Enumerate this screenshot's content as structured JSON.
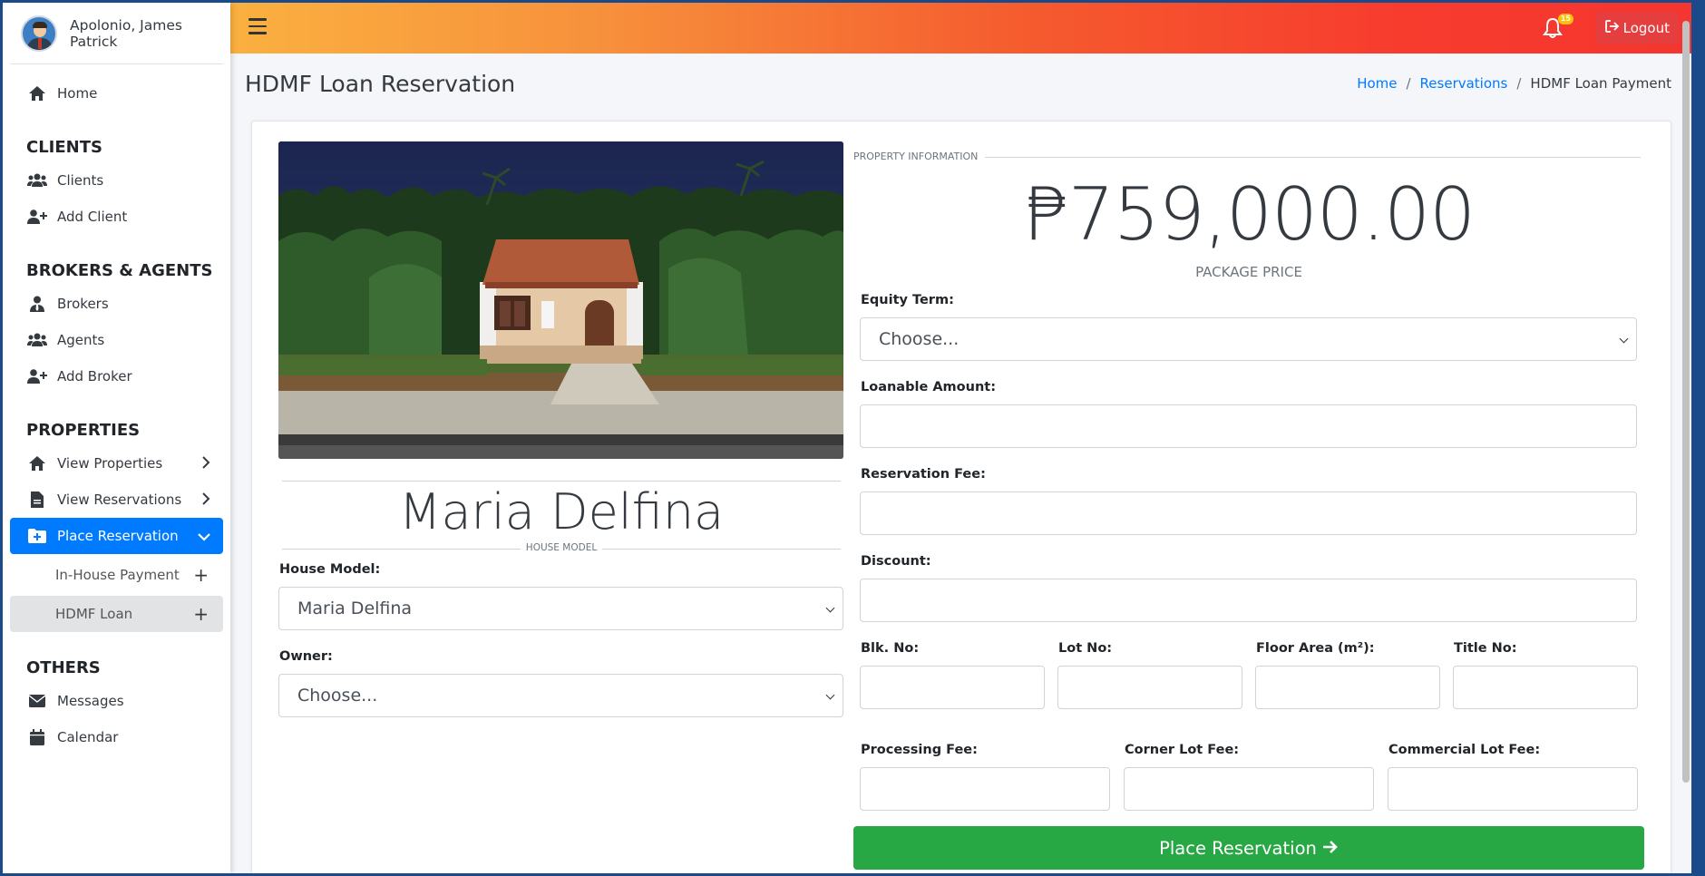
{
  "user": {
    "name": "Apolonio, James Patrick"
  },
  "sidebar": {
    "home": "Home",
    "sections": [
      {
        "header": "CLIENTS",
        "items": [
          {
            "label": "Clients",
            "icon": "users-icon"
          },
          {
            "label": "Add Client",
            "icon": "user-plus-icon"
          }
        ]
      },
      {
        "header": "BROKERS & AGENTS",
        "items": [
          {
            "label": "Brokers",
            "icon": "user-tie-icon"
          },
          {
            "label": "Agents",
            "icon": "users-icon"
          },
          {
            "label": "Add Broker",
            "icon": "user-plus-icon"
          }
        ]
      },
      {
        "header": "PROPERTIES",
        "items": [
          {
            "label": "View Properties",
            "icon": "home-icon"
          },
          {
            "label": "View Reservations",
            "icon": "file-icon"
          },
          {
            "label": "Place Reservation",
            "icon": "folder-plus-icon"
          }
        ]
      },
      {
        "header": "OTHERS",
        "items": [
          {
            "label": "Messages",
            "icon": "envelope-icon"
          },
          {
            "label": "Calendar",
            "icon": "calendar-icon"
          }
        ]
      }
    ],
    "subitems": [
      {
        "label": "In-House Payment"
      },
      {
        "label": "HDMF Loan"
      }
    ]
  },
  "topbar": {
    "notification_count": "15",
    "logout": "Logout"
  },
  "page": {
    "title": "HDMF Loan Reservation",
    "breadcrumb": [
      "Home",
      "Reservations",
      "HDMF Loan Payment"
    ]
  },
  "house": {
    "name": "Maria Delfina",
    "caption": "HOUSE MODEL",
    "model_label": "House Model:",
    "model_value": "Maria Delfina",
    "owner_label": "Owner:",
    "owner_value": "Choose..."
  },
  "property": {
    "legend": "PROPERTY INFORMATION",
    "price": "₱759,000.00",
    "price_caption": "PACKAGE PRICE",
    "equity_label": "Equity Term:",
    "equity_value": "Choose...",
    "loanable_label": "Loanable Amount:",
    "reservation_fee_label": "Reservation Fee:",
    "discount_label": "Discount:",
    "blk_label": "Blk. No:",
    "lot_label": "Lot No:",
    "floor_label": "Floor Area (m²):",
    "title_label": "Title No:",
    "processing_label": "Processing Fee:",
    "corner_label": "Corner Lot Fee:",
    "commercial_label": "Commercial Lot Fee:"
  },
  "submit": {
    "label": "Place Reservation"
  },
  "colors": {
    "primary": "#007bff",
    "success": "#28a745",
    "danger": "#e53e3e"
  }
}
